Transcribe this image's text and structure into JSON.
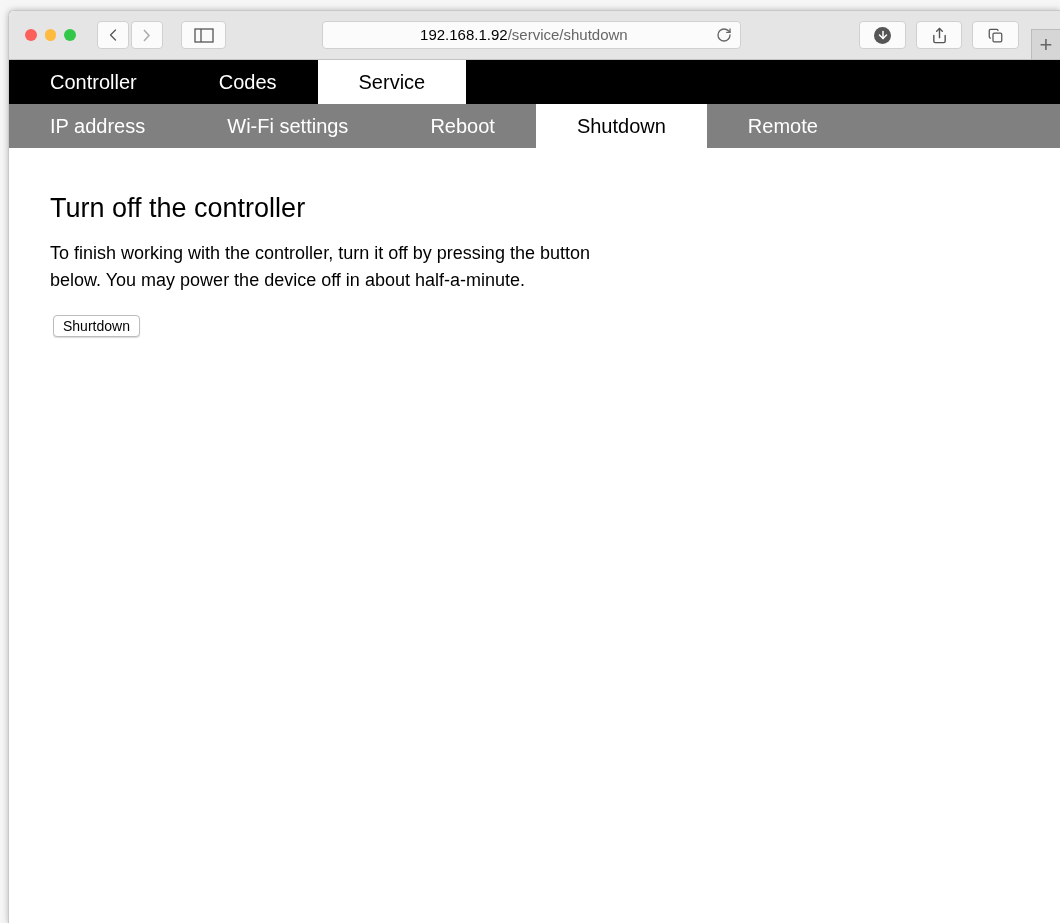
{
  "browser": {
    "url_host": "192.168.1.92",
    "url_path": "/service/shutdown",
    "new_tab": "+"
  },
  "main_tabs": [
    {
      "label": "Controller",
      "selected": false
    },
    {
      "label": "Codes",
      "selected": false
    },
    {
      "label": "Service",
      "selected": true
    }
  ],
  "sub_tabs": [
    {
      "label": "IP address",
      "selected": false
    },
    {
      "label": "Wi-Fi settings",
      "selected": false
    },
    {
      "label": "Reboot",
      "selected": false
    },
    {
      "label": "Shutdown",
      "selected": true
    },
    {
      "label": "Remote",
      "selected": false
    }
  ],
  "content": {
    "heading": "Turn off the controller",
    "text": "To finish working with the controller, turn it off by pressing the button below. You may power the device off in about half-a-minute.",
    "button": "Shurtdown"
  }
}
